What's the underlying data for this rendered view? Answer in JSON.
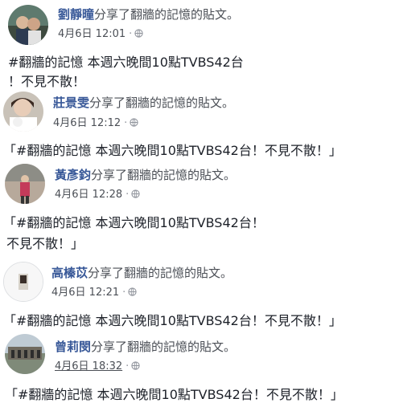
{
  "posts": [
    {
      "name": "劉靜曈",
      "action": "分享了翻牆的記憶的貼文。",
      "time": "4月6日 12:01",
      "text_hashtag": "#翻牆的記憶",
      "text_line1": " 本週六晚間10點TVBS42台",
      "text_line2": "！不見不散！"
    },
    {
      "name": "莊景雯",
      "action": "分享了翻牆的記憶的貼文。",
      "time": "4月6日 12:12",
      "text_prefix": "「",
      "text_hashtag": "#翻牆的記憶",
      "text_line1": " 本週六晚間10點TVBS42台！不見不散！」"
    },
    {
      "name": "黃彥鈞",
      "action": "分享了翻牆的記憶的貼文。",
      "time": "4月6日 12:28",
      "text_prefix": "「",
      "text_hashtag": "#翻牆的記憶",
      "text_line1": " 本週六晚間10點TVBS42台！",
      "text_line2": "不見不散！」"
    },
    {
      "name": "高榛苡",
      "action": "分享了翻牆的記憶的貼文。",
      "time": "4月6日 12:21",
      "text_prefix": "「",
      "text_hashtag": "#翻牆的記憶",
      "text_line1": " 本週六晚間10點TVBS42台！不見不散！」"
    },
    {
      "name": "曾莉閔",
      "action": "分享了翻牆的記憶的貼文。",
      "time": "4月6日 18:32",
      "text_prefix": "「",
      "text_hashtag": "#翻牆的記憶",
      "text_line1": " 本週六晚間10點TVBS42台！不見不散！」"
    }
  ],
  "separator": "·",
  "icons": {
    "privacy": "globe-icon"
  },
  "colors": {
    "name": "#385898",
    "meta": "#4b4f56",
    "text": "#1d2129"
  }
}
